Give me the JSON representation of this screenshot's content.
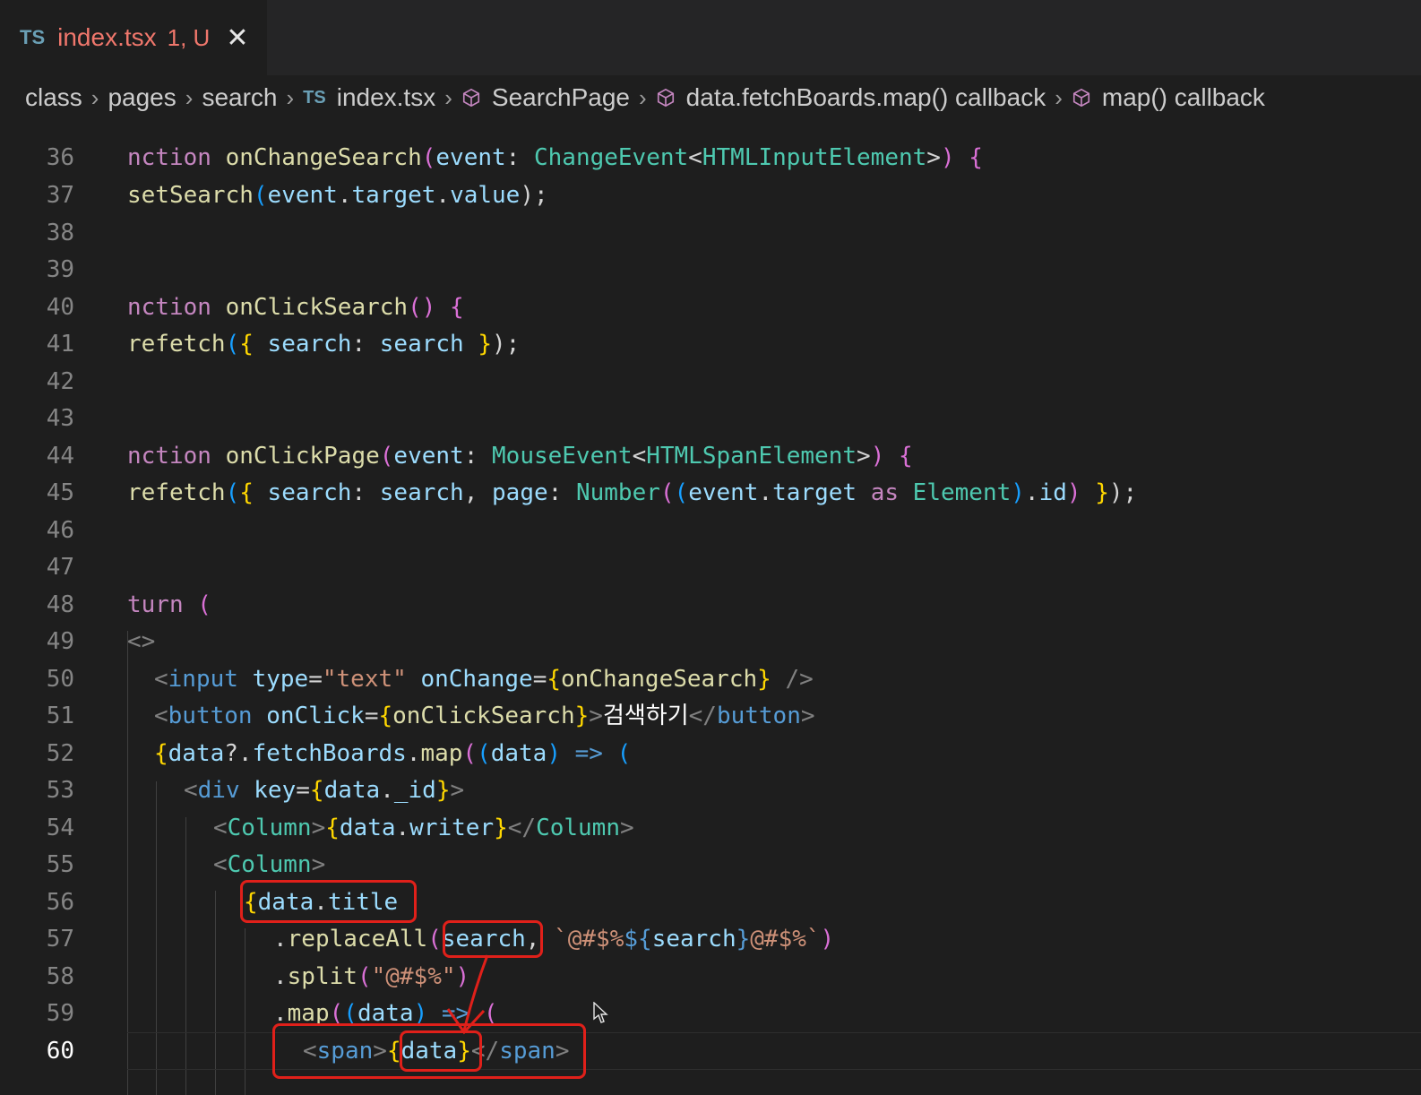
{
  "tab": {
    "filetype": "TS",
    "name": "index.tsx",
    "status": "1, U",
    "close_glyph": "✕"
  },
  "breadcrumb": {
    "items": [
      "class",
      "pages",
      "search"
    ],
    "file_type": "TS",
    "file": "index.tsx",
    "symbols": [
      "SearchPage",
      "data.fetchBoards.map() callback",
      "map() callback"
    ],
    "separator": "›"
  },
  "editor": {
    "active_line": 60,
    "lines": [
      {
        "n": "36"
      },
      {
        "n": "37"
      },
      {
        "n": "38"
      },
      {
        "n": "39"
      },
      {
        "n": "40"
      },
      {
        "n": "41"
      },
      {
        "n": "42"
      },
      {
        "n": "43"
      },
      {
        "n": "44"
      },
      {
        "n": "45"
      },
      {
        "n": "46"
      },
      {
        "n": "47"
      },
      {
        "n": "48"
      },
      {
        "n": "49"
      },
      {
        "n": "50"
      },
      {
        "n": "51"
      },
      {
        "n": "52"
      },
      {
        "n": "53"
      },
      {
        "n": "54"
      },
      {
        "n": "55"
      },
      {
        "n": "56"
      },
      {
        "n": "57"
      },
      {
        "n": "58"
      },
      {
        "n": "59"
      },
      {
        "n": "60"
      }
    ],
    "code": {
      "l36": [
        "nction ",
        "onChangeSearch",
        "(",
        "event",
        ": ",
        "ChangeEvent",
        "<",
        "HTMLInputElement",
        ">",
        ")",
        " {"
      ],
      "l37": [
        "setSearch",
        "(",
        "event",
        ".",
        "target",
        ".",
        "value",
        ");"
      ],
      "l40": [
        "nction ",
        "onClickSearch",
        "()",
        " {"
      ],
      "l41": [
        "refetch",
        "(",
        "{",
        " search",
        ": ",
        "search",
        " ",
        "}",
        ");"
      ],
      "l44": [
        "nction ",
        "onClickPage",
        "(",
        "event",
        ": ",
        "MouseEvent",
        "<",
        "HTMLSpanElement",
        ">",
        ")",
        " {"
      ],
      "l45": [
        "refetch",
        "(",
        "{",
        " search",
        ": ",
        "search",
        ", ",
        "page",
        ": ",
        "Number",
        "(",
        "(",
        "event",
        ".",
        "target",
        " as ",
        "Element",
        ")",
        ".",
        "id",
        ")",
        " ",
        "}",
        ");"
      ],
      "l48": [
        "turn ",
        "("
      ],
      "l49": [
        "<>"
      ],
      "l50": [
        "<",
        "input",
        " type",
        "=",
        "\"text\"",
        " onChange",
        "=",
        "{",
        "onChangeSearch",
        "}",
        " />"
      ],
      "l51": [
        "<",
        "button",
        " onClick",
        "=",
        "{",
        "onClickSearch",
        "}",
        ">",
        "검색하기",
        "</",
        "button",
        ">"
      ],
      "l52": [
        "{",
        "data",
        "?.",
        "fetchBoards",
        ".",
        "map",
        "(",
        "(",
        "data",
        ")",
        " => ",
        "("
      ],
      "l53": [
        "<",
        "div",
        " key",
        "=",
        "{",
        "data",
        ".",
        "_id",
        "}",
        ">"
      ],
      "l54": [
        "<",
        "Column",
        ">",
        "{",
        "data",
        ".",
        "writer",
        "}",
        "</",
        "Column",
        ">"
      ],
      "l55": [
        "<",
        "Column",
        ">"
      ],
      "l56": [
        "{",
        "data",
        ".",
        "title"
      ],
      "l57": [
        ".",
        "replaceAll",
        "(",
        "search",
        ", ",
        "`@#$%",
        "${",
        "search",
        "}",
        "@#$%`",
        ")"
      ],
      "l58": [
        ".",
        "split",
        "(",
        "\"@#$%\"",
        ")"
      ],
      "l59": [
        ".",
        "map",
        "(",
        "(",
        "data",
        ")",
        " => ",
        "("
      ],
      "l60": [
        "<",
        "span",
        ">",
        "{",
        "data",
        "}",
        "</",
        "span",
        ">"
      ]
    }
  },
  "colors": {
    "annotation": "#e0201a",
    "keyword": "#c586c0",
    "function": "#dcdcaa",
    "variable": "#9cdcfe",
    "type": "#4ec9b0",
    "tag": "#569cd6",
    "string": "#ce9178",
    "modified_tab": "#f0776c"
  }
}
